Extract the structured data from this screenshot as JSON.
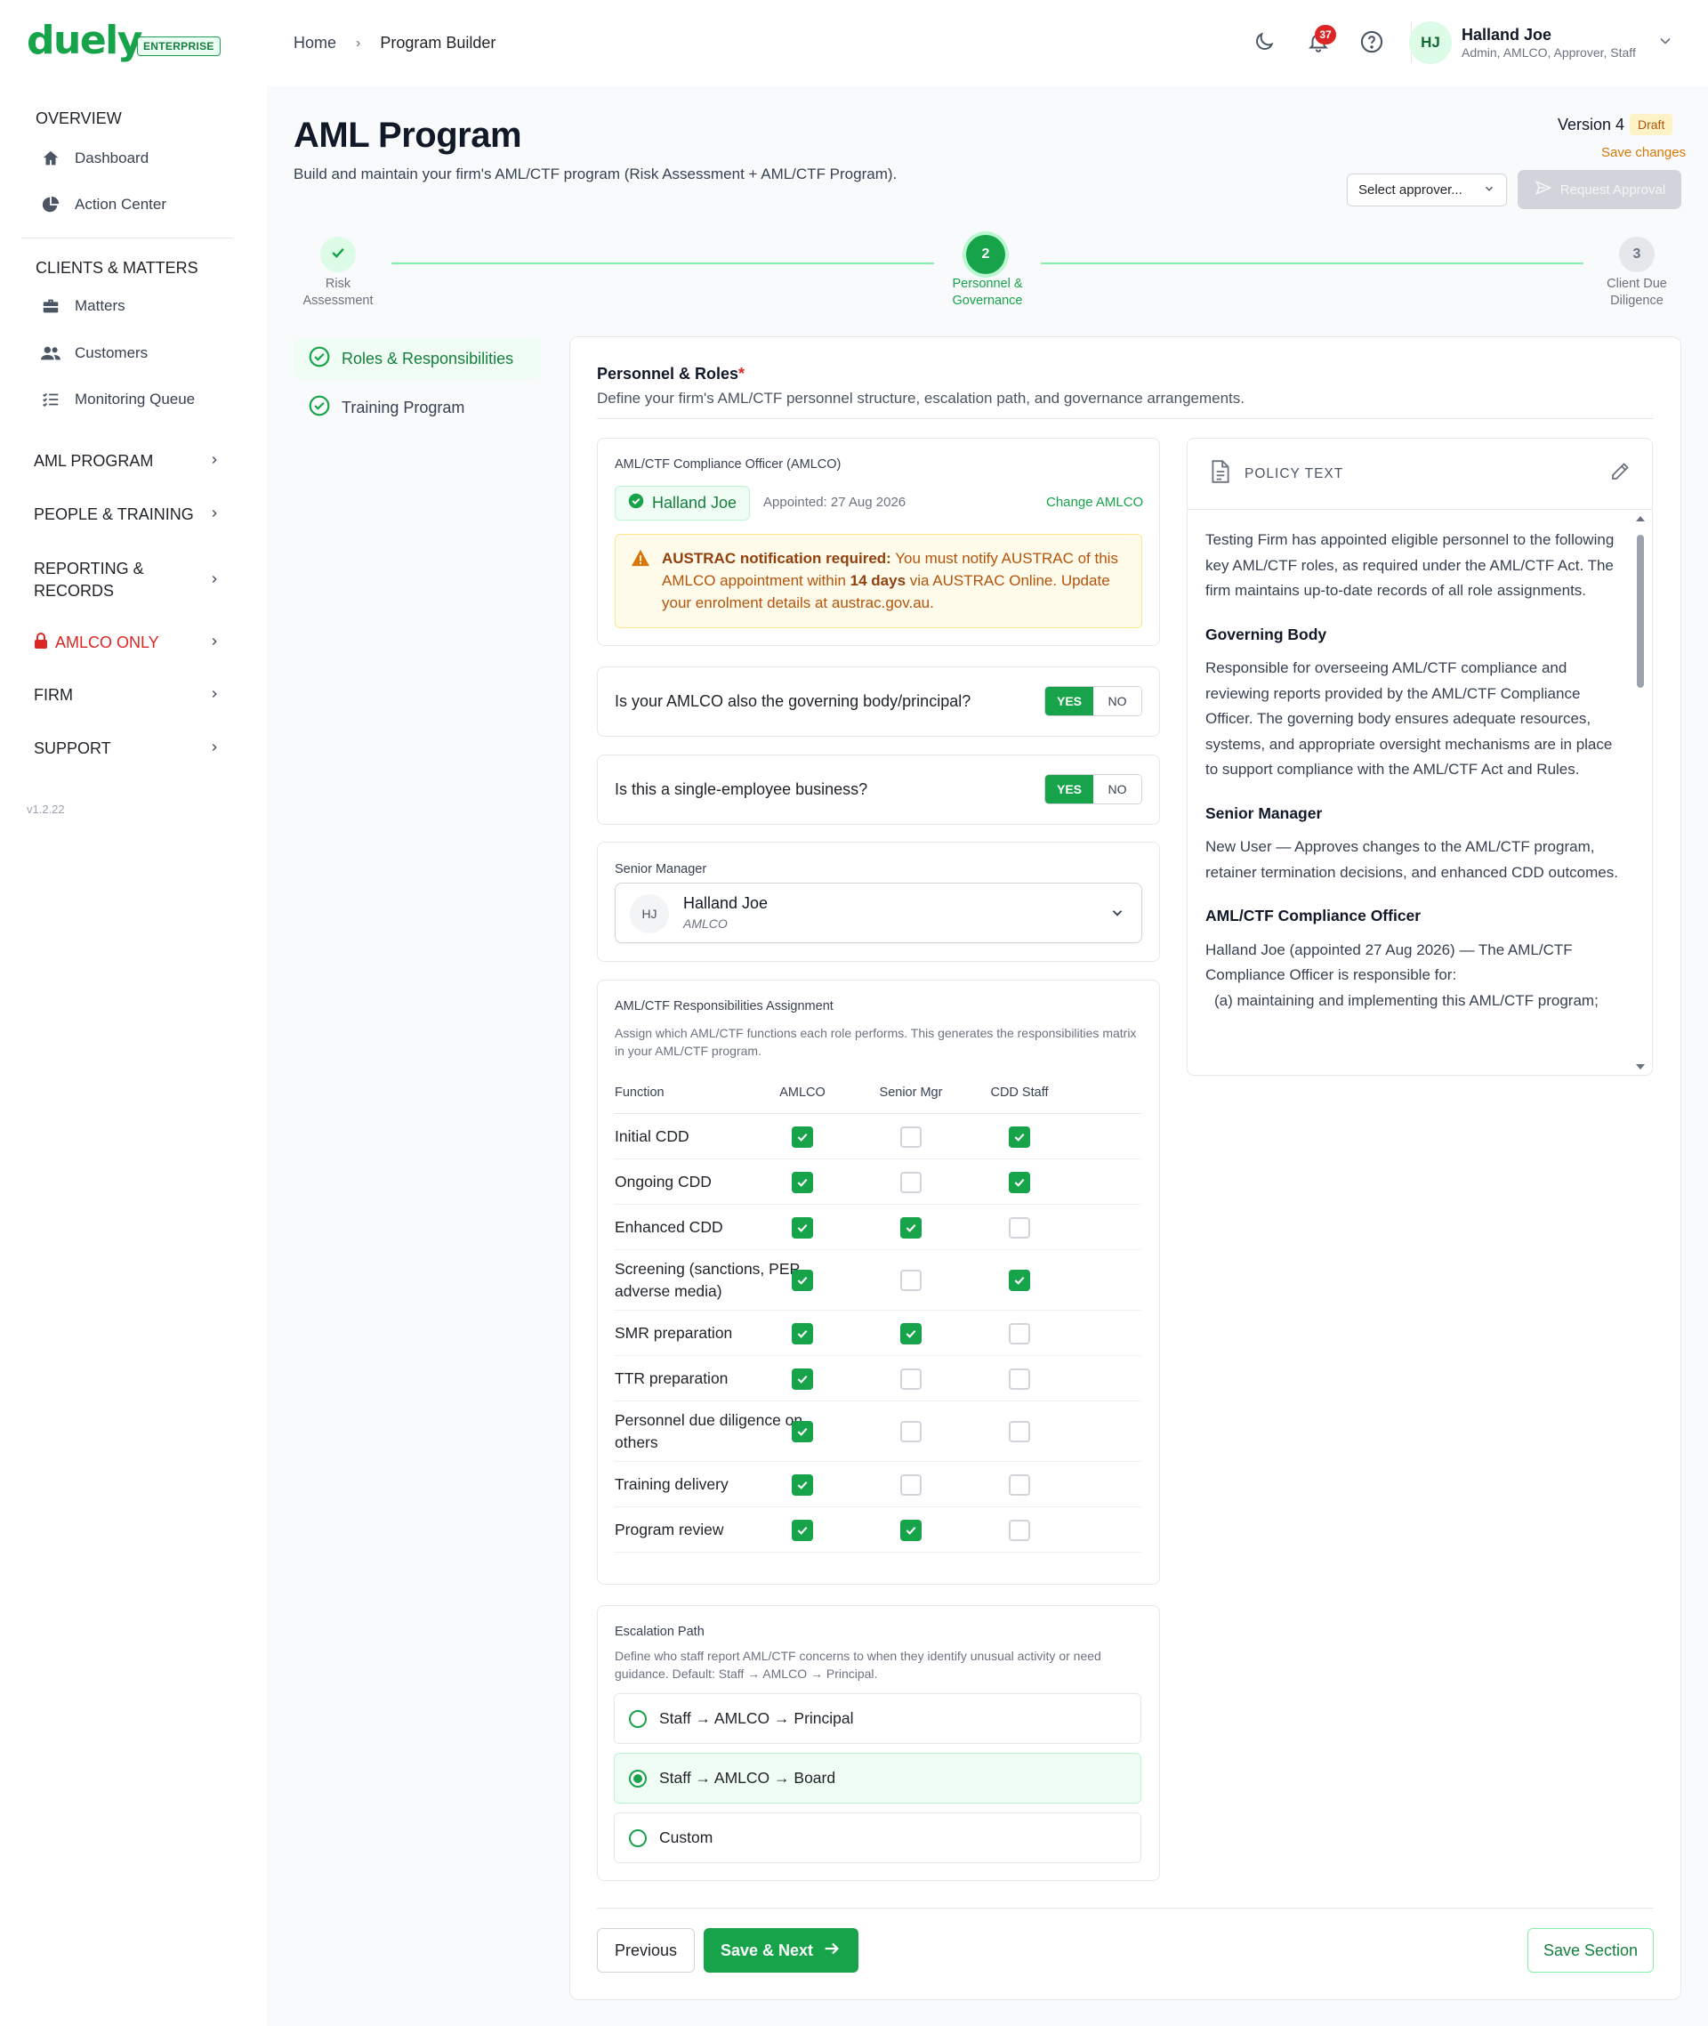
{
  "brand": {
    "logo": "duely",
    "badge": "ENTERPRISE"
  },
  "breadcrumb": {
    "home": "Home",
    "separator": "›",
    "current": "Program Builder"
  },
  "topbar": {
    "notification_count": "37",
    "user": {
      "initials": "HJ",
      "name": "Halland Joe",
      "roles": "Admin, AMLCO, Approver, Staff"
    }
  },
  "sidebar": {
    "overview_title": "OVERVIEW",
    "overview_items": [
      {
        "label": "Dashboard",
        "icon": "home-icon"
      },
      {
        "label": "Action Center",
        "icon": "pie-chart-icon"
      }
    ],
    "clients_title": "CLIENTS & MATTERS",
    "clients_items": [
      {
        "label": "Matters",
        "icon": "briefcase-icon"
      },
      {
        "label": "Customers",
        "icon": "users-icon"
      },
      {
        "label": "Monitoring Queue",
        "icon": "list-check-icon"
      }
    ],
    "groups": [
      "AML PROGRAM",
      "PEOPLE & TRAINING",
      "REPORTING & RECORDS",
      "AMLCO ONLY",
      "FIRM",
      "SUPPORT"
    ],
    "version": "v1.2.22"
  },
  "page": {
    "title": "AML Program",
    "subtitle": "Build and maintain your firm's AML/CTF program (Risk Assessment + AML/CTF Program).",
    "version_label": "Version 4",
    "status_badge": "Draft",
    "save_changes": "Save changes",
    "approver_placeholder": "Select approver...",
    "request_approval": "Request Approval"
  },
  "stepper": {
    "steps": [
      {
        "number": "✓",
        "label_1": "Risk",
        "label_2": "Assessment",
        "state": "done"
      },
      {
        "number": "2",
        "label_1": "Personnel &",
        "label_2": "Governance",
        "state": "active"
      },
      {
        "number": "3",
        "label_1": "Client Due",
        "label_2": "Diligence",
        "state": "todo"
      }
    ]
  },
  "subnav": [
    {
      "label": "Roles & Responsibilities",
      "active": true
    },
    {
      "label": "Training Program",
      "active": false
    }
  ],
  "section": {
    "title": "Personnel & Roles",
    "required_mark": "*",
    "description": "Define your firm's AML/CTF personnel structure, escalation path, and governance arrangements."
  },
  "amlco": {
    "label": "AML/CTF Compliance Officer (AMLCO)",
    "name": "Halland Joe",
    "appointed": "Appointed: 27 Aug 2026",
    "change_link": "Change AMLCO",
    "alert_strong": "AUSTRAC notification required:",
    "alert_pre": " You must notify AUSTRAC of this AMLCO appointment within ",
    "alert_days": "14 days",
    "alert_post": " via AUSTRAC Online. Update your enrolment details at austrac.gov.au."
  },
  "questions": [
    {
      "text": "Is your AMLCO also the governing body/principal?",
      "yes": "YES",
      "no": "NO",
      "value": "YES"
    },
    {
      "text": "Is this a single-employee business?",
      "yes": "YES",
      "no": "NO",
      "value": "YES"
    }
  ],
  "senior_manager": {
    "label": "Senior Manager",
    "initials": "HJ",
    "name": "Halland Joe",
    "role": "AMLCO"
  },
  "responsibilities": {
    "title": "AML/CTF Responsibilities Assignment",
    "description": "Assign which AML/CTF functions each role performs. This generates the responsibilities matrix in your AML/CTF program.",
    "columns": [
      "Function",
      "AMLCO",
      "Senior Mgr",
      "CDD Staff"
    ],
    "rows": [
      {
        "function": "Initial CDD",
        "checks": [
          true,
          false,
          true
        ]
      },
      {
        "function": "Ongoing CDD",
        "checks": [
          true,
          false,
          true
        ]
      },
      {
        "function": "Enhanced CDD",
        "checks": [
          true,
          true,
          false
        ]
      },
      {
        "function": "Screening (sanctions, PEP, adverse media)",
        "checks": [
          true,
          false,
          true
        ]
      },
      {
        "function": "SMR preparation",
        "checks": [
          true,
          true,
          false
        ]
      },
      {
        "function": "TTR preparation",
        "checks": [
          true,
          false,
          false
        ]
      },
      {
        "function": "Personnel due diligence on others",
        "checks": [
          true,
          false,
          false
        ]
      },
      {
        "function": "Training delivery",
        "checks": [
          true,
          false,
          false
        ]
      },
      {
        "function": "Program review",
        "checks": [
          true,
          true,
          false
        ]
      }
    ]
  },
  "escalation": {
    "title": "Escalation Path",
    "description": "Define who staff report AML/CTF concerns to when they identify unusual activity or need guidance. Default: Staff → AMLCO → Principal.",
    "options": [
      {
        "label": "Staff → AMLCO → Principal",
        "selected": false
      },
      {
        "label": "Staff → AMLCO → Board",
        "selected": true
      },
      {
        "label": "Custom",
        "selected": false
      }
    ]
  },
  "policy": {
    "header": "POLICY TEXT",
    "intro": "Testing Firm has appointed eligible personnel to the following key AML/CTF roles, as required under the AML/CTF Act. The firm maintains up-to-date records of all role assignments.",
    "h1": "Governing Body",
    "p1": "Responsible for overseeing AML/CTF compliance and reviewing reports provided by the AML/CTF Compliance Officer. The governing body ensures adequate resources, systems, and appropriate oversight mechanisms are in place to support compliance with the AML/CTF Act and Rules.",
    "h2": "Senior Manager",
    "p2": "New User — Approves changes to the AML/CTF program, retainer termination decisions, and enhanced CDD outcomes.",
    "h3": "AML/CTF Compliance Officer",
    "p3": "Halland Joe (appointed 27 Aug 2026) — The AML/CTF Compliance Officer is responsible for:",
    "p3a": "(a) maintaining and implementing this AML/CTF program;"
  },
  "footer": {
    "previous": "Previous",
    "save_next": "Save & Next",
    "save_section": "Save Section"
  },
  "colors": {
    "brand": "#16a34a",
    "accent_light": "#f0fdf4",
    "alert_bg": "#fffbeb",
    "alert_text": "#b45309",
    "danger": "#dc2626"
  }
}
